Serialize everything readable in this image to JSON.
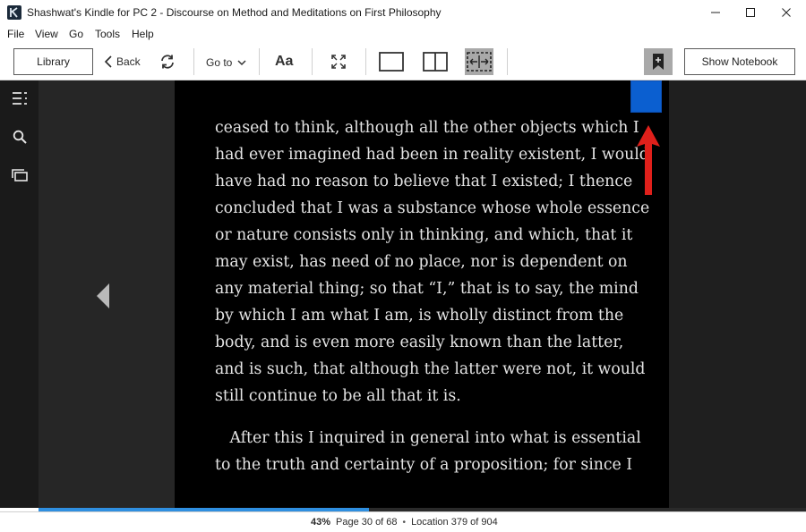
{
  "window": {
    "title": "Shashwat's Kindle for PC 2 - Discourse on Method and Meditations on First Philosophy"
  },
  "menu": {
    "items": [
      "File",
      "View",
      "Go",
      "Tools",
      "Help"
    ]
  },
  "toolbar": {
    "library_label": "Library",
    "back_label": "Back",
    "goto_label": "Go to",
    "font_label": "Aa",
    "notebook_label": "Show Notebook"
  },
  "book": {
    "paragraph1": [
      "ceased to think, although all the other objects which I",
      "had ever imagined had been in reality existent, I would",
      "have had no reason to believe that I existed; I thence",
      "concluded that I was a substance whose whole essence",
      "or nature consists only in thinking, and which, that it",
      "may exist, has need of no place, nor is dependent on",
      "any material thing; so that “I,” that is to say, the mind",
      "by which I am what I am, is wholly distinct from the",
      "body, and is even more easily known than the latter,",
      "and is such, that although the latter were not, it would",
      "still continue to be all that it is."
    ],
    "paragraph2": [
      "   After this I inquired in general into what is essential",
      "to the truth and certainty of a proposition; for since I"
    ]
  },
  "status": {
    "percent": "43%",
    "page": "Page 30 of 68",
    "location": "Location 379 of 904",
    "progress_fraction": 0.43
  },
  "colors": {
    "bookmark": "#0b5fd0",
    "annotation_arrow": "#e0201b",
    "progress": "#2f8fe0"
  },
  "icons": {
    "rail": [
      "toc-icon",
      "search-icon",
      "flashcards-icon"
    ],
    "toolbar": [
      "back-chevron-icon",
      "sync-icon",
      "chevron-down-icon",
      "fullscreen-icon",
      "single-page-icon",
      "two-page-icon",
      "fit-width-icon",
      "bookmark-add-icon"
    ]
  }
}
